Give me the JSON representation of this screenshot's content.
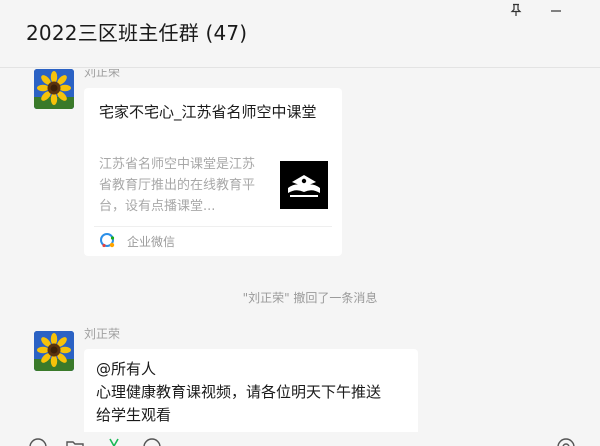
{
  "header": {
    "title": "2022三区班主任群 (47)"
  },
  "window_controls": {
    "pin": "pin-icon",
    "minimize": "minimize-icon"
  },
  "messages": [
    {
      "sender": "刘正荣",
      "type": "link-card",
      "card": {
        "title": "宅家不宅心_江苏省名师空中课堂",
        "description": "江苏省名师空中课堂是江苏省教育厅推出的在线教育平台，设有点播课堂...",
        "source": "企业微信",
        "thumbnail": "book-logo"
      }
    },
    {
      "type": "system",
      "text": "\"刘正荣\" 撤回了一条消息"
    },
    {
      "sender": "刘正荣",
      "type": "text",
      "lines": [
        "@所有人",
        "心理健康教育课视频，请各位明天下午推送",
        "给学生观看"
      ]
    }
  ],
  "toolbar": {
    "icons": [
      "emoji-icon",
      "folder-icon",
      "scissors-icon",
      "chat-history-icon",
      "voice-call-icon"
    ]
  },
  "colors": {
    "background": "#f5f5f5",
    "bubble": "#ffffff",
    "muted_text": "#a0a0a0",
    "primary_text": "#1a1a1a",
    "accent_green": "#19b955"
  }
}
